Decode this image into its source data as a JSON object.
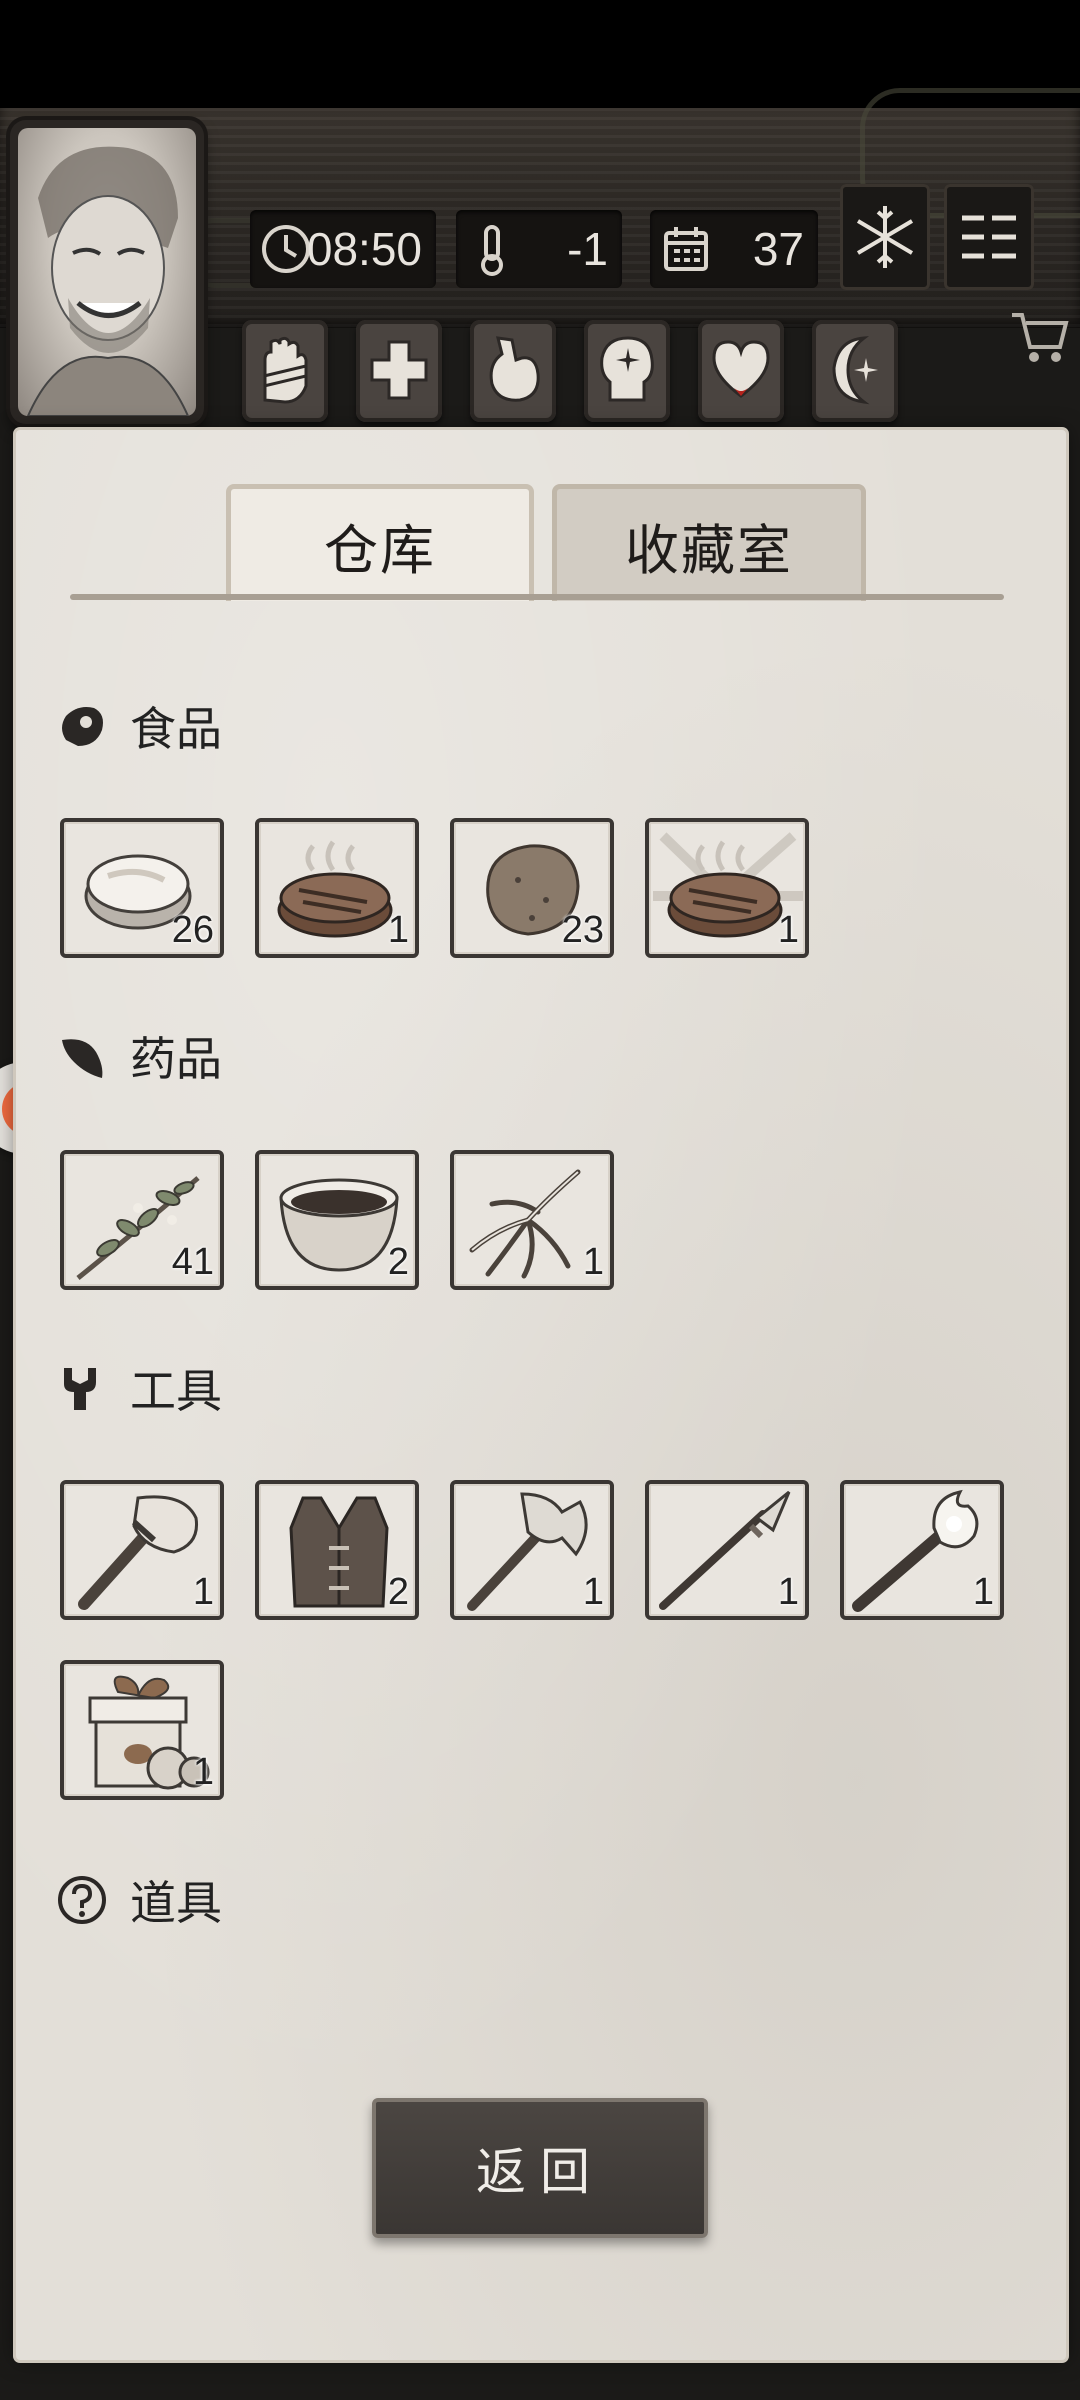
{
  "hud": {
    "time": "08:50",
    "temperature": "-1",
    "day": "37",
    "weather_icon": "snowflake-icon",
    "menu_icon": "menu-icon"
  },
  "status_tabs": [
    "hand-bandage-icon",
    "medical-cross-icon",
    "stomach-icon",
    "mind-icon",
    "heart-icon",
    "moon-icon"
  ],
  "tabs": {
    "warehouse": "仓库",
    "collection": "收藏室"
  },
  "sections": {
    "food": {
      "title": "食品",
      "items": [
        {
          "icon": "raw-meat-icon",
          "count": "26"
        },
        {
          "icon": "cooked-steak-icon",
          "count": "1"
        },
        {
          "icon": "potato-icon",
          "count": "23"
        },
        {
          "icon": "grilled-steak-icon",
          "count": "1"
        }
      ]
    },
    "medicine": {
      "title": "药品",
      "items": [
        {
          "icon": "herb-branch-icon",
          "count": "41"
        },
        {
          "icon": "medicine-bowl-icon",
          "count": "2"
        },
        {
          "icon": "ginseng-root-icon",
          "count": "1"
        }
      ]
    },
    "tools": {
      "title": "工具",
      "items": [
        {
          "icon": "stone-hammer-icon",
          "count": "1"
        },
        {
          "icon": "leather-vest-icon",
          "count": "2"
        },
        {
          "icon": "axe-icon",
          "count": "1"
        },
        {
          "icon": "spear-icon",
          "count": "1"
        },
        {
          "icon": "torch-icon",
          "count": "1"
        },
        {
          "icon": "gift-box-icon",
          "count": "1"
        }
      ]
    },
    "props": {
      "title": "道具",
      "items": []
    }
  },
  "buttons": {
    "back": "返回"
  },
  "colors": {
    "paper": "#e3dfd8",
    "wood": "#2e2a26",
    "slot_border": "#3a3633",
    "button": "#3f3b37"
  }
}
